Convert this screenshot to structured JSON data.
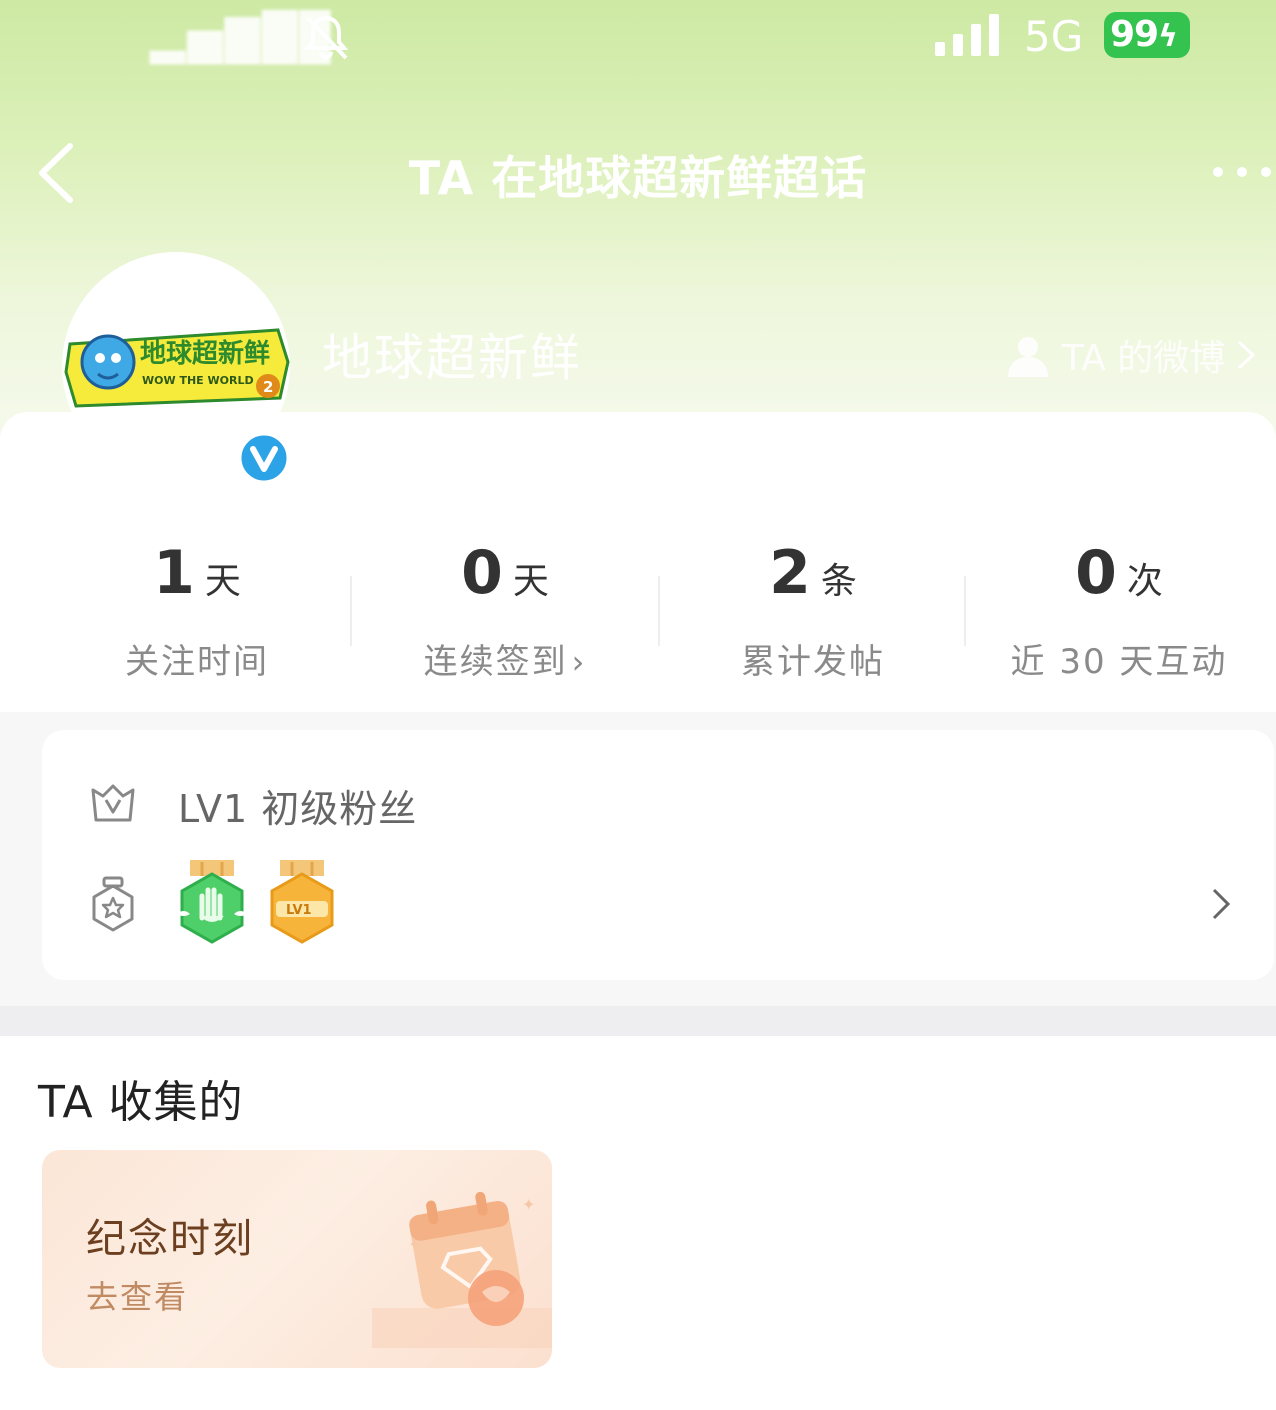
{
  "status_bar": {
    "time": "▂▅▇█▉",
    "network": "5G",
    "battery": "99"
  },
  "nav": {
    "title": "TA 在地球超新鲜超话"
  },
  "profile": {
    "name": "地球超新鲜",
    "weibo_link": "TA 的微博",
    "avatar_text": "地球超新鲜",
    "avatar_subtext": "WOW THE WORLD",
    "avatar_season": "2"
  },
  "stats": [
    {
      "value": "1",
      "unit": "天",
      "label": "关注时间",
      "arrow": ""
    },
    {
      "value": "0",
      "unit": "天",
      "label": "连续签到",
      "arrow": "›"
    },
    {
      "value": "2",
      "unit": "条",
      "label": "累计发帖",
      "arrow": ""
    },
    {
      "value": "0",
      "unit": "次",
      "label": "近 30 天互动",
      "arrow": ""
    }
  ],
  "level": {
    "text": "LV1 初级粉丝",
    "badge_lv1": "LV1"
  },
  "collection": {
    "title": "TA 收集的",
    "card_title": "纪念时刻",
    "card_action": "去查看"
  },
  "colors": {
    "accent_green": "#cde9a3",
    "battery_green": "#35c34f",
    "verified_blue": "#2ba3e6",
    "card_warm": "#fbe6d7"
  },
  "icons": [
    "bell-muted-icon",
    "signal-icon",
    "back-icon",
    "more-icon",
    "person-icon",
    "chevron-right-icon",
    "verified-icon",
    "crown-icon",
    "medal-icon",
    "hand-badge-icon",
    "lv1-badge-icon",
    "calendar-heart-icon"
  ]
}
